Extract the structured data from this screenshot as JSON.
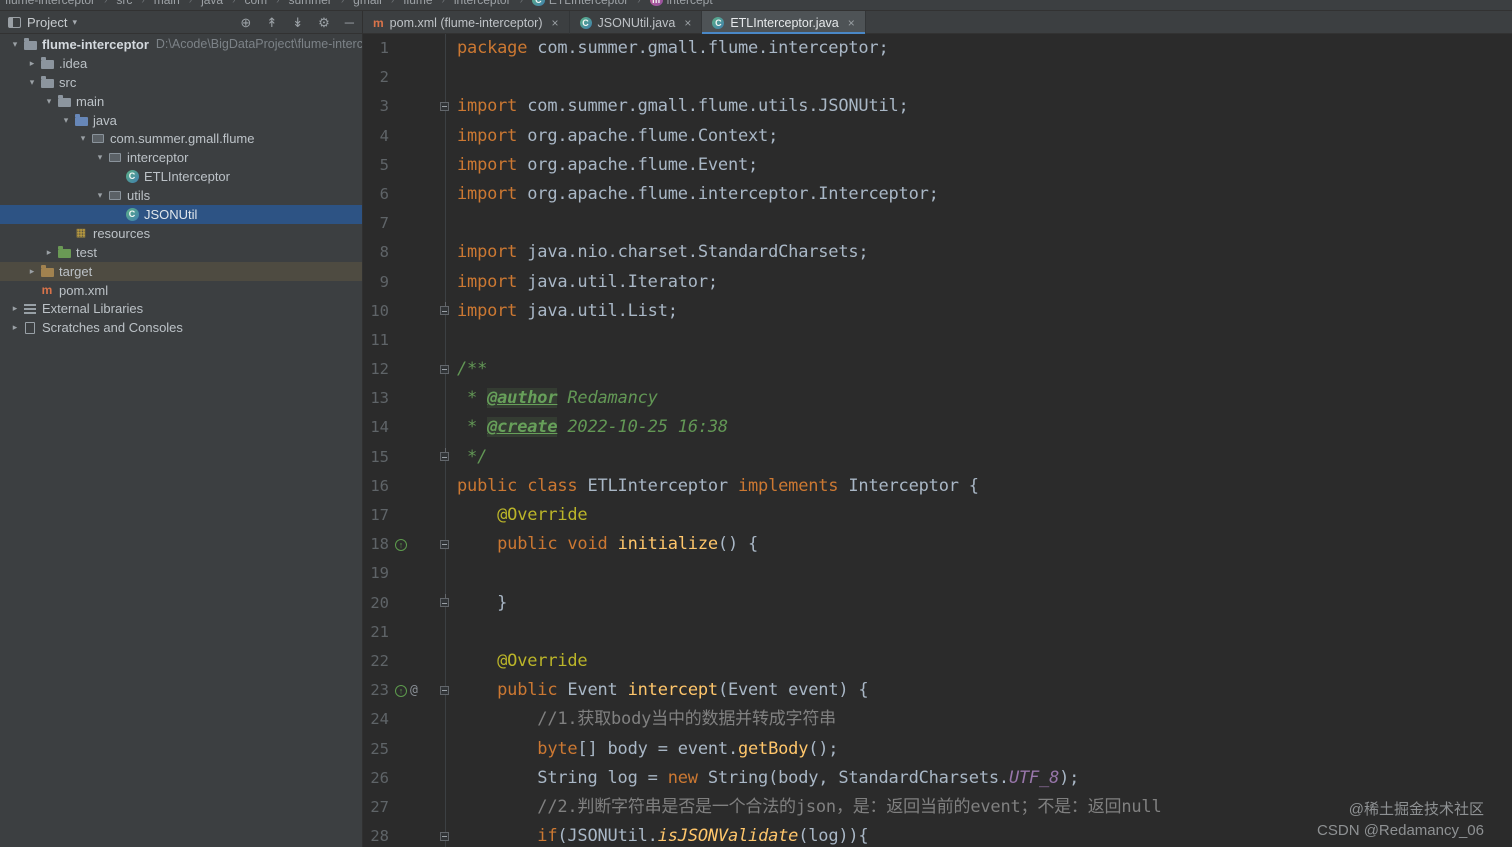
{
  "topnav": {
    "items": [
      "flume-interceptor",
      "src",
      "main",
      "java",
      "com",
      "summer",
      "gmall",
      "flume",
      "interceptor"
    ],
    "class_name": "ETLInterceptor",
    "method_name": "intercept"
  },
  "project": {
    "title": "Project",
    "toolbar": [
      {
        "name": "locate-icon",
        "glyph": "⊕"
      },
      {
        "name": "expand-all-icon",
        "glyph": "↟"
      },
      {
        "name": "collapse-all-icon",
        "glyph": "↡"
      },
      {
        "name": "settings-gear-icon",
        "glyph": "⚙"
      },
      {
        "name": "hide-panel-icon",
        "glyph": "─"
      }
    ],
    "tree": [
      {
        "label": "flume-interceptor",
        "path": "D:\\Acode\\BigDataProject\\flume-interce",
        "icon": "folder",
        "chevron": "down",
        "indent": 0,
        "bold": true
      },
      {
        "label": ".idea",
        "icon": "folder",
        "chevron": "right",
        "indent": 1
      },
      {
        "label": "src",
        "icon": "folder",
        "chevron": "down",
        "indent": 1
      },
      {
        "label": "main",
        "icon": "folder",
        "chevron": "down",
        "indent": 2
      },
      {
        "label": "java",
        "icon": "folder-java",
        "chevron": "down",
        "indent": 3
      },
      {
        "label": "com.summer.gmall.flume",
        "icon": "package",
        "chevron": "down",
        "indent": 4
      },
      {
        "label": "interceptor",
        "icon": "package",
        "chevron": "down",
        "indent": 5
      },
      {
        "label": "ETLInterceptor",
        "icon": "class",
        "chevron": "none",
        "indent": 6
      },
      {
        "label": "utils",
        "icon": "package",
        "chevron": "down",
        "indent": 5
      },
      {
        "label": "JSONUtil",
        "icon": "class",
        "chevron": "none",
        "indent": 6,
        "state": "selected"
      },
      {
        "label": "resources",
        "icon": "resources",
        "chevron": "none",
        "indent": 3
      },
      {
        "label": "test",
        "icon": "folder-test",
        "chevron": "right",
        "indent": 2
      },
      {
        "label": "target",
        "icon": "folder-target",
        "chevron": "right",
        "indent": 1,
        "state": "highlight"
      },
      {
        "label": "pom.xml",
        "icon": "maven",
        "chevron": "none",
        "indent": 1
      },
      {
        "label": "External Libraries",
        "icon": "library",
        "chevron": "right",
        "indent": 0
      },
      {
        "label": "Scratches and Consoles",
        "icon": "scratches",
        "chevron": "right",
        "indent": 0
      }
    ]
  },
  "tabs": [
    {
      "label": "pom.xml (flume-interceptor)",
      "icon": "maven",
      "active": false
    },
    {
      "label": "JSONUtil.java",
      "icon": "class",
      "active": false
    },
    {
      "label": "ETLInterceptor.java",
      "icon": "class",
      "active": true
    }
  ],
  "editor": {
    "lines": [
      {
        "n": 1,
        "fold": null,
        "g": null,
        "t": [
          [
            "kw",
            "package"
          ],
          [
            "def",
            " com.summer.gmall.flume.interceptor;"
          ]
        ]
      },
      {
        "n": 2,
        "fold": null,
        "g": null,
        "t": []
      },
      {
        "n": 3,
        "fold": "start",
        "g": null,
        "t": [
          [
            "kw",
            "import"
          ],
          [
            "def",
            " com.summer.gmall.flume.utils.JSONUtil;"
          ]
        ]
      },
      {
        "n": 4,
        "fold": null,
        "g": null,
        "t": [
          [
            "kw",
            "import"
          ],
          [
            "def",
            " org.apache.flume.Context;"
          ]
        ]
      },
      {
        "n": 5,
        "fold": null,
        "g": null,
        "t": [
          [
            "kw",
            "import"
          ],
          [
            "def",
            " org.apache.flume.Event;"
          ]
        ]
      },
      {
        "n": 6,
        "fold": null,
        "g": null,
        "t": [
          [
            "kw",
            "import"
          ],
          [
            "def",
            " org.apache.flume.interceptor.Interceptor;"
          ]
        ]
      },
      {
        "n": 7,
        "fold": null,
        "g": null,
        "t": []
      },
      {
        "n": 8,
        "fold": null,
        "g": null,
        "t": [
          [
            "kw",
            "import"
          ],
          [
            "def",
            " java.nio.charset.StandardCharsets;"
          ]
        ]
      },
      {
        "n": 9,
        "fold": null,
        "g": null,
        "t": [
          [
            "kw",
            "import"
          ],
          [
            "def",
            " java.util.Iterator;"
          ]
        ]
      },
      {
        "n": 10,
        "fold": "end",
        "g": null,
        "t": [
          [
            "kw",
            "import"
          ],
          [
            "def",
            " java.util.List;"
          ]
        ]
      },
      {
        "n": 11,
        "fold": null,
        "g": null,
        "t": []
      },
      {
        "n": 12,
        "fold": "start",
        "g": null,
        "t": [
          [
            "doc",
            "/**"
          ]
        ]
      },
      {
        "n": 13,
        "fold": null,
        "g": null,
        "t": [
          [
            "doc",
            " * "
          ],
          [
            "doctag",
            "@author"
          ],
          [
            "doc",
            " Redamancy"
          ]
        ]
      },
      {
        "n": 14,
        "fold": null,
        "g": null,
        "t": [
          [
            "doc",
            " * "
          ],
          [
            "doctag",
            "@create"
          ],
          [
            "doc",
            " 2022-10-25 16:38"
          ]
        ]
      },
      {
        "n": 15,
        "fold": "end",
        "g": null,
        "t": [
          [
            "doc",
            " */"
          ]
        ]
      },
      {
        "n": 16,
        "fold": null,
        "g": null,
        "t": [
          [
            "kw",
            "public class"
          ],
          [
            "def",
            " ETLInterceptor "
          ],
          [
            "kw",
            "implements"
          ],
          [
            "def",
            " Interceptor {"
          ]
        ]
      },
      {
        "n": 17,
        "fold": null,
        "g": null,
        "t": [
          [
            "def",
            "    "
          ],
          [
            "ann",
            "@Override"
          ]
        ]
      },
      {
        "n": 18,
        "fold": "start",
        "g": "ovr",
        "t": [
          [
            "def",
            "    "
          ],
          [
            "kw",
            "public void "
          ],
          [
            "mname",
            "initialize"
          ],
          [
            "def",
            "() {"
          ]
        ]
      },
      {
        "n": 19,
        "fold": null,
        "g": null,
        "t": []
      },
      {
        "n": 20,
        "fold": "end",
        "g": null,
        "t": [
          [
            "def",
            "    }"
          ]
        ]
      },
      {
        "n": 21,
        "fold": null,
        "g": null,
        "t": []
      },
      {
        "n": 22,
        "fold": null,
        "g": null,
        "t": [
          [
            "def",
            "    "
          ],
          [
            "ann",
            "@Override"
          ]
        ]
      },
      {
        "n": 23,
        "fold": "start",
        "g": "ovr-ann",
        "t": [
          [
            "def",
            "    "
          ],
          [
            "kw",
            "public"
          ],
          [
            "def",
            " Event "
          ],
          [
            "mname",
            "intercept"
          ],
          [
            "def",
            "(Event event) {"
          ]
        ]
      },
      {
        "n": 24,
        "fold": null,
        "g": null,
        "t": [
          [
            "def",
            "        "
          ],
          [
            "cmt",
            "//1.获取body当中的数据并转成字符串"
          ]
        ]
      },
      {
        "n": 25,
        "fold": null,
        "g": null,
        "t": [
          [
            "def",
            "        "
          ],
          [
            "kw",
            "byte"
          ],
          [
            "def",
            "[] body = event."
          ],
          [
            "mname",
            "getBody"
          ],
          [
            "def",
            "();"
          ]
        ]
      },
      {
        "n": 26,
        "fold": null,
        "g": null,
        "t": [
          [
            "def",
            "        String log = "
          ],
          [
            "kw",
            "new"
          ],
          [
            "def",
            " String(body, StandardCharsets."
          ],
          [
            "sfield",
            "UTF_8"
          ],
          [
            "def",
            ");"
          ]
        ]
      },
      {
        "n": 27,
        "fold": null,
        "g": null,
        "t": [
          [
            "def",
            "        "
          ],
          [
            "cmt",
            "//2.判断字符串是否是一个合法的json，是：返回当前的event；不是：返回null"
          ]
        ]
      },
      {
        "n": 28,
        "fold": "start",
        "g": null,
        "t": [
          [
            "def",
            "        "
          ],
          [
            "kw",
            "if"
          ],
          [
            "def",
            "(JSONUtil."
          ],
          [
            "smethod",
            "isJSONValidate"
          ],
          [
            "def",
            "(log)){"
          ]
        ]
      }
    ]
  },
  "watermark": {
    "line1": "@稀土掘金技术社区",
    "line2": "CSDN @Redamancy_06"
  },
  "colors": {
    "editor_background": "#2b2b2b",
    "panel_background": "#3c3f41",
    "keyword": "#cc7832",
    "default_text": "#a9b7c6",
    "javadoc": "#629755",
    "line_comment": "#808080",
    "annotation": "#bbb529",
    "method_name": "#ffc66b",
    "static_constant": "#9876aa",
    "line_number": "#5f6468",
    "tree_selection": "#2d5384",
    "active_tab_underline": "#4a88c7"
  }
}
